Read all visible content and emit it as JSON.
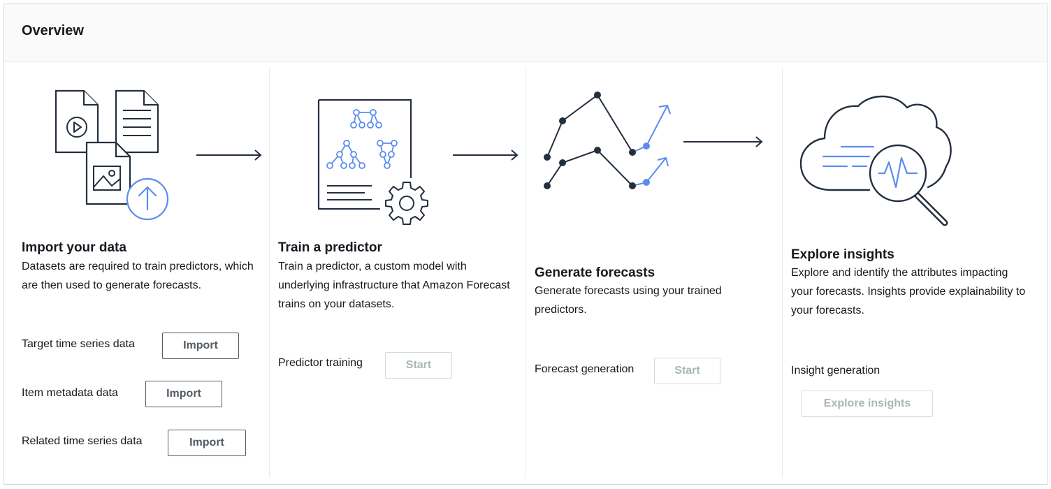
{
  "overview": {
    "title": "Overview"
  },
  "steps": [
    {
      "title": "Import your data",
      "description": "Datasets are required to train predictors, which are then used to generate forecasts.",
      "rows": [
        {
          "label": "Target time series data",
          "button": "Import",
          "enabled": true
        },
        {
          "label": "Item metadata data",
          "button": "Import",
          "enabled": true
        },
        {
          "label": "Related time series data",
          "button": "Import",
          "enabled": true
        }
      ]
    },
    {
      "title": "Train a predictor",
      "description": "Train a predictor, a custom model with underlying infrastructure that Amazon Forecast trains on your datasets.",
      "rows": [
        {
          "label": "Predictor training",
          "button": "Start",
          "enabled": false
        }
      ]
    },
    {
      "title": "Generate forecasts",
      "description": "Generate forecasts using your trained predictors.",
      "rows": [
        {
          "label": "Forecast generation",
          "button": "Start",
          "enabled": false
        }
      ]
    },
    {
      "title": "Explore insights",
      "description": "Explore and identify the attributes impacting your forecasts. Insights provide explainability to your forecasts.",
      "rows": [
        {
          "label": "Insight generation",
          "button": "Explore insights",
          "enabled": false
        }
      ]
    }
  ],
  "colors": {
    "accent": "#5a8dee",
    "ink": "#232f3e",
    "disabled": "#aab7b8",
    "border": "#545b64"
  }
}
